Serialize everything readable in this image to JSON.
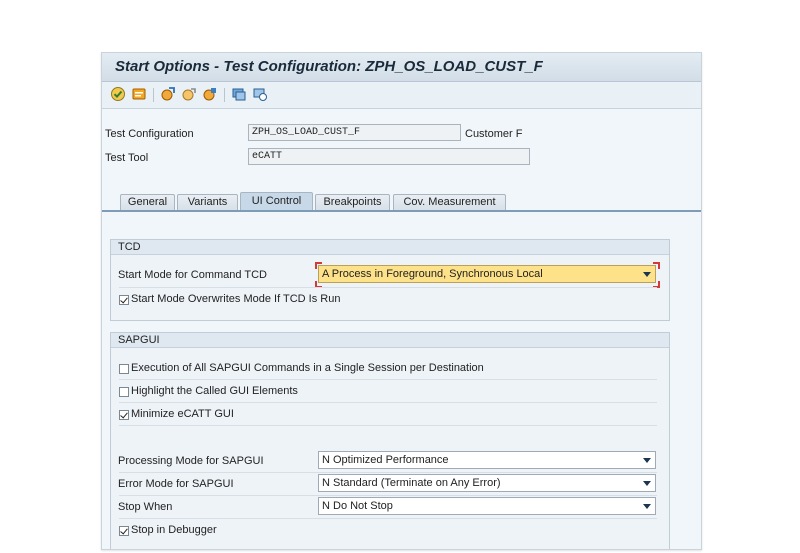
{
  "window": {
    "title": "Start Options - Test Configuration: ZPH_OS_LOAD_CUST_F"
  },
  "toolbar": {
    "icons": [
      "execute-icon",
      "stop-icon",
      "import-icon",
      "copy-icon",
      "variant-icon",
      "system-data-icon",
      "cross-system-icon"
    ]
  },
  "header": {
    "test_config_label": "Test Configuration",
    "test_config_value": "ZPH_OS_LOAD_CUST_F",
    "test_config_desc": "Customer F",
    "test_tool_label": "Test Tool",
    "test_tool_value": "eCATT"
  },
  "tabs": [
    {
      "label": "General"
    },
    {
      "label": "Variants"
    },
    {
      "label": "UI Control",
      "active": true
    },
    {
      "label": "Breakpoints"
    },
    {
      "label": "Cov. Measurement"
    }
  ],
  "tcd": {
    "title": "TCD",
    "start_mode_label": "Start Mode for Command TCD",
    "start_mode_value": "A Process in Foreground, Synchronous Local",
    "overwrite_label": "Start Mode Overwrites Mode If TCD Is Run",
    "overwrite_checked": true
  },
  "sapgui": {
    "title": "SAPGUI",
    "single_session_label": "Execution of All SAPGUI Commands in a Single Session per Destination",
    "single_session_checked": false,
    "highlight_label": "Highlight the Called GUI Elements",
    "highlight_checked": false,
    "minimize_label": "Minimize eCATT GUI",
    "minimize_checked": true,
    "processing_mode_label": "Processing Mode for SAPGUI",
    "processing_mode_value": "N Optimized Performance",
    "error_mode_label": "Error Mode for SAPGUI",
    "error_mode_value": "N Standard (Terminate on Any Error)",
    "stop_when_label": "Stop When",
    "stop_when_value": "N Do Not Stop",
    "debugger_label": "Stop in Debugger",
    "debugger_checked": true
  },
  "colors": {
    "highlight": "#fde28a",
    "tab_active": "#c7d8e8",
    "tab_line": "#7e9cb8",
    "panel": "#eef3f8"
  }
}
